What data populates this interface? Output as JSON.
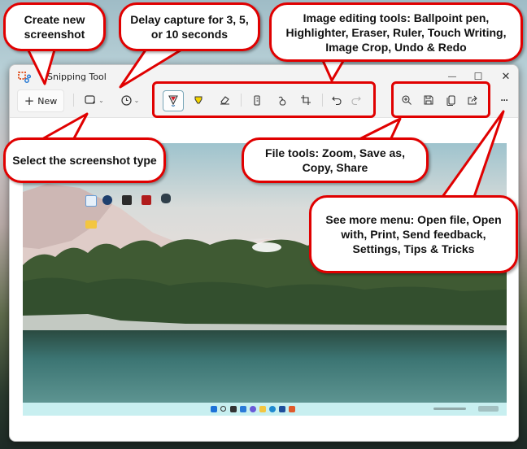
{
  "window": {
    "title": "Snipping Tool",
    "controls": {
      "minimize": "minimize-icon",
      "maximize": "maximize-icon",
      "close": "close-icon"
    }
  },
  "toolbar": {
    "new_label": "New",
    "new_icon": "plus-icon",
    "mode_icon": "rectangle-snip-icon",
    "delay_icon": "clock-icon",
    "editing_tools": [
      "ballpoint-pen-icon",
      "highlighter-icon",
      "eraser-icon",
      "ruler-icon",
      "touch-writing-icon",
      "crop-icon",
      "undo-icon",
      "redo-icon"
    ],
    "file_tools": [
      "zoom-icon",
      "save-icon",
      "copy-icon",
      "share-icon"
    ],
    "more_icon": "more-icon",
    "glyphs": {
      "plus": "+",
      "caret": "⌄",
      "more": "···",
      "minimize": "—",
      "maximize": "☐",
      "close": "✕"
    }
  },
  "callouts": {
    "new": "Create new screenshot",
    "delay": "Delay capture for 3, 5, or 10 seconds",
    "editing": "Image editing tools: Ballpoint pen, Highlighter, Eraser, Ruler, Touch Writing, Image Crop, Undo & Redo",
    "type": "Select the screenshot type",
    "file": "File tools: Zoom, Save as, Copy, Share",
    "more": "See more menu: Open file, Open with, Print, Send feedback, Settings, Tips & Tricks"
  },
  "colors": {
    "callout_border": "#e00000",
    "accent": "#0f6cbd"
  }
}
